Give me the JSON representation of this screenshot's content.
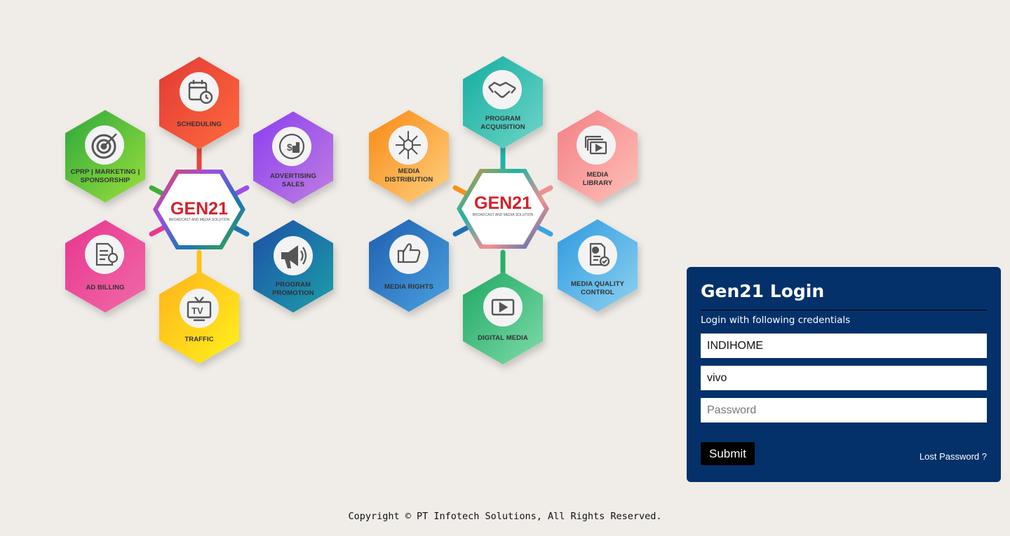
{
  "left_cluster": {
    "center_title": "GEN21",
    "center_subtitle": "BROADCAST AND MEDIA SOLUTION",
    "modules": [
      {
        "name": "scheduling",
        "lines": [
          "SCHEDULING"
        ],
        "icon": "calendar-clock-icon",
        "color": "#e8473a"
      },
      {
        "name": "advertising-sales",
        "lines": [
          "ADVERTISING",
          "SALES"
        ],
        "icon": "dollar-chart-icon",
        "color": "#9b4fe6"
      },
      {
        "name": "program-promotion",
        "lines": [
          "PROGRAM",
          "PROMOTION"
        ],
        "icon": "megaphone-icon",
        "color": "#1d74b5"
      },
      {
        "name": "traffic",
        "lines": [
          "TRAFFIC"
        ],
        "icon": "tv-icon",
        "color": "#ffc21a"
      },
      {
        "name": "ad-billing",
        "lines": [
          "AD BILLING"
        ],
        "icon": "invoice-icon",
        "color": "#e8398f"
      },
      {
        "name": "cprp-marketing-sponsorship",
        "lines": [
          "CPRP | MARKETING |",
          "SPONSORSHIP"
        ],
        "icon": "target-icon",
        "color": "#3fae3a"
      }
    ]
  },
  "right_cluster": {
    "center_title": "GEN21",
    "center_subtitle": "BROADCAST AND MEDIA SOLUTION",
    "modules": [
      {
        "name": "program-acquisition",
        "lines": [
          "PROGRAM",
          "ACQUISITION"
        ],
        "icon": "handshake-icon",
        "color": "#1fb3a8"
      },
      {
        "name": "media-library",
        "lines": [
          "MEDIA",
          "LIBRARY"
        ],
        "icon": "video-library-icon",
        "color": "#f48f90"
      },
      {
        "name": "media-quality-control",
        "lines": [
          "MEDIA QUALITY",
          "CONTROL"
        ],
        "icon": "quality-report-icon",
        "color": "#3aa3e0"
      },
      {
        "name": "digital-media",
        "lines": [
          "DIGITAL MEDIA"
        ],
        "icon": "play-icon",
        "color": "#25b06a"
      },
      {
        "name": "media-rights",
        "lines": [
          "MEDIA RIGHTS"
        ],
        "icon": "thumbs-up-icon",
        "color": "#1f6fba"
      },
      {
        "name": "media-distribution",
        "lines": [
          "MEDIA",
          "DISTRIBUTION"
        ],
        "icon": "distribution-icon",
        "color": "#f7921c"
      }
    ]
  },
  "login": {
    "title": "Gen21 Login",
    "subtitle": "Login with following credentials",
    "company_value": "INDIHOME",
    "username_value": "vivo",
    "password_placeholder": "Password",
    "submit_label": "Submit",
    "lost_password_label": "Lost Password ?"
  },
  "footer": {
    "copyright": "Copyright © PT Infotech Solutions, All Rights Reserved."
  },
  "colors": {
    "panel_bg": "#04316a",
    "page_bg": "#f0ede8"
  }
}
